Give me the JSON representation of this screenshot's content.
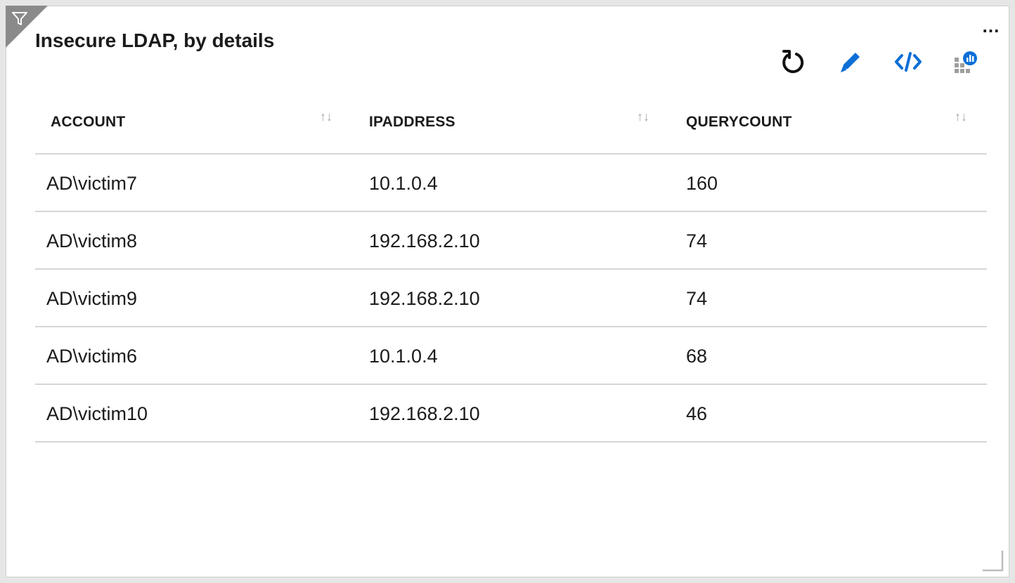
{
  "tile": {
    "title": "Insecure LDAP, by details",
    "more_label": "…"
  },
  "toolbar": {
    "icons": [
      "refresh-icon",
      "edit-pencil-icon",
      "code-icon",
      "open-in-logs-icon"
    ],
    "colors": {
      "refresh": "#111111",
      "accent": "#0b6fd6"
    }
  },
  "table": {
    "columns": [
      {
        "label": "ACCOUNT",
        "sort": "↑↓"
      },
      {
        "label": "IPADDRESS",
        "sort": "↑↓"
      },
      {
        "label": "QUERYCOUNT",
        "sort": "↑↓"
      }
    ],
    "rows": [
      {
        "account": "AD\\victim7",
        "ip": "10.1.0.4",
        "count": "160"
      },
      {
        "account": "AD\\victim8",
        "ip": "192.168.2.10",
        "count": "74"
      },
      {
        "account": "AD\\victim9",
        "ip": "192.168.2.10",
        "count": "74"
      },
      {
        "account": "AD\\victim6",
        "ip": "10.1.0.4",
        "count": "68"
      },
      {
        "account": "AD\\victim10",
        "ip": "192.168.2.10",
        "count": "46"
      }
    ]
  }
}
